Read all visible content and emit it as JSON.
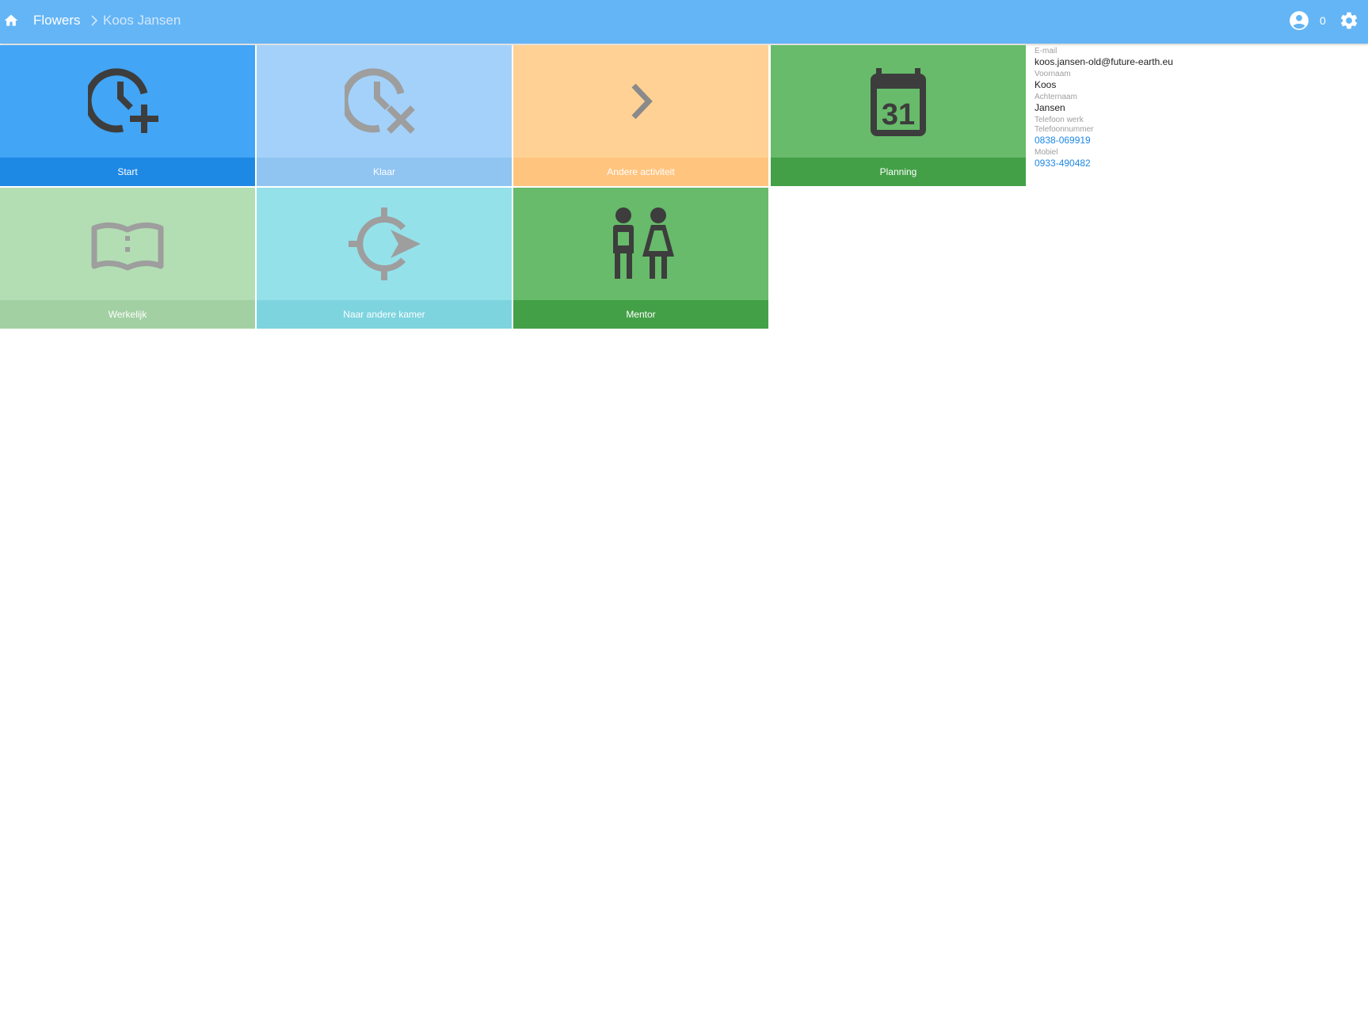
{
  "header": {
    "home_icon": "home-icon",
    "breadcrumb_root": "Flowers",
    "breadcrumb_current": "Koos Jansen",
    "account_icon": "account-circle-icon",
    "count": "0",
    "settings_icon": "gear-icon",
    "bar_color": "#64b5f6"
  },
  "tiles": [
    {
      "label": "Start",
      "icon": "clock-plus-icon",
      "color": "#42a5f5"
    },
    {
      "label": "Klaar",
      "icon": "clock-x-icon",
      "color": "#a3d1fa"
    },
    {
      "label": "Andere activiteit",
      "icon": "chevron-right-icon",
      "color": "#ffd194"
    },
    {
      "label": "Planning",
      "icon": "calendar-icon",
      "icon_text": "31",
      "color": "#67bb6a"
    },
    {
      "label": "Werkelijk",
      "icon": "open-book-icon",
      "color": "#b3ddb3"
    },
    {
      "label": "Naar andere kamer",
      "icon": "transfer-arrow-icon",
      "color": "#95e1ea"
    },
    {
      "label": "Mentor",
      "icon": "people-icon",
      "color": "#67bb6a"
    }
  ],
  "profile": {
    "email_label": "E-mail",
    "email": "koos.jansen-old@future-earth.eu",
    "first_name_label": "Voornaam",
    "first_name": "Koos",
    "last_name_label": "Achternaam",
    "last_name": "Jansen",
    "work_phone_label": "Telefoon werk",
    "phone_label": "Telefoonnummer",
    "phone": "0838-069919",
    "mobile_label": "Mobiel",
    "mobile": "0933-490482"
  }
}
